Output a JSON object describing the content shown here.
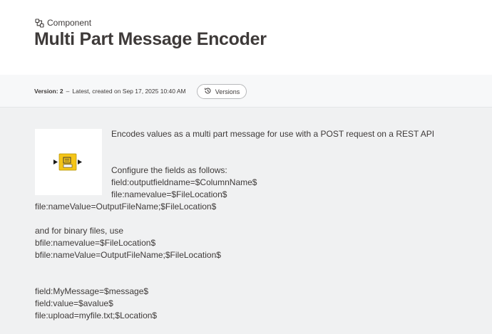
{
  "breadcrumb": {
    "icon": "component-icon",
    "label": "Component"
  },
  "title": "Multi Part Message Encoder",
  "version": {
    "label": "Version: 2",
    "separator": "–",
    "info": "Latest, created on Sep 17, 2025 10:40 AM",
    "button_label": "Versions",
    "button_icon": "history-icon"
  },
  "node_icon": {
    "name": "multipart-encoder-node-icon",
    "color": "#f5c518"
  },
  "description": {
    "intro": "Encodes values as a multi part message for use with a POST request on a REST API",
    "configure_heading": "Configure the fields as follows:",
    "config_line1": "field:outputfieldname=$ColumnName$",
    "config_line2": "file:namevalue=$FileLocation$",
    "config_line3": "file:nameValue=OutputFileName;$FileLocation$",
    "binary_heading": "and for binary files, use",
    "binary_line1": "bfile:namevalue=$FileLocation$",
    "binary_line2": "bfile:nameValue=OutputFileName;$FileLocation$",
    "example_line1": "field:MyMessage=$message$",
    "example_line2": "field:value=$avalue$",
    "example_line3": "file:upload=myfile.txt;$Location$"
  }
}
